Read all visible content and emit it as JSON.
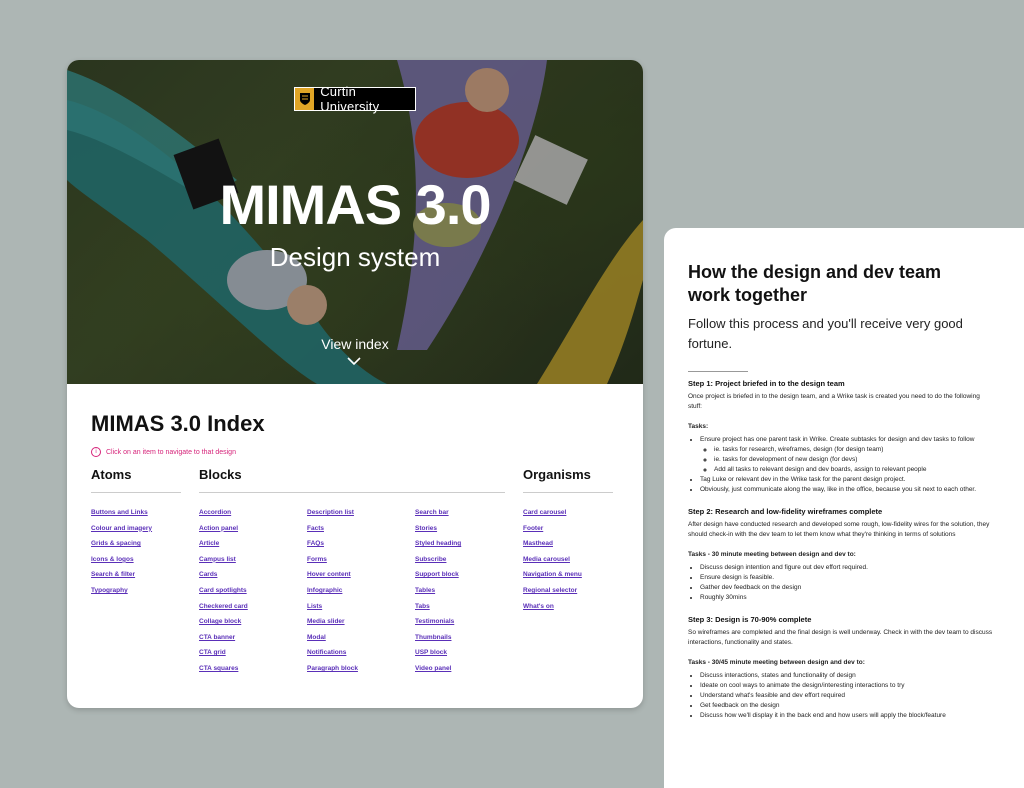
{
  "hero": {
    "brand": "Curtin University",
    "title": "MIMAS 3.0",
    "subtitle": "Design system",
    "view_index": "View index"
  },
  "index": {
    "title": "MIMAS 3.0 Index",
    "hint": "Click on an item to navigate to that design",
    "atoms": {
      "heading": "Atoms",
      "items": [
        "Buttons and Links",
        "Colour and imagery",
        "Grids & spacing",
        "Icons & logos",
        "Search & filter",
        "Typography"
      ]
    },
    "blocks": {
      "heading": "Blocks",
      "col1": [
        "Accordion",
        "Action panel",
        "Article",
        "Campus list",
        "Cards",
        "Card spotlights",
        "Checkered card",
        "Collage block",
        "CTA banner",
        "CTA grid",
        "CTA squares"
      ],
      "col2": [
        "Description list",
        "Facts",
        "FAQs",
        "Forms",
        "Hover content",
        "Infographic",
        "Lists",
        "Media slider",
        "Modal",
        "Notifications",
        "Paragraph block"
      ],
      "col3": [
        "Search bar",
        "Stories",
        "Styled heading",
        "Subscribe",
        "Support block",
        "Tables",
        "Tabs",
        "Testimonials",
        "Thumbnails",
        "USP block",
        "Video panel"
      ]
    },
    "organisms": {
      "heading": "Organisms",
      "items": [
        "Card carousel",
        "Footer",
        "Masthead",
        "Media carousel",
        "Navigation & menu",
        "Regional selector",
        "What's on"
      ]
    }
  },
  "process": {
    "title": "How the design and dev team work together",
    "intro": "Follow this process and you'll receive very good fortune.",
    "step1": {
      "heading": "Step 1: Project briefed in to the design team",
      "desc": "Once project is briefed in to the design team, and a Wrike task is created you need to do the following stuff:",
      "tasks_label": "Tasks:",
      "t1": "Ensure project has one parent task in Wrike. Create subtasks for design and dev tasks to follow",
      "t1a": "ie. tasks for research, wireframes, design (for design team)",
      "t1b": "ie. tasks for development of new design (for devs)",
      "t1c": "Add all tasks to relevant design and dev boards, assign to relevant people",
      "t2": "Tag Luke or relevant dev in the Wrike task for the parent design project.",
      "t3": "Obviously, just communicate along the way, like in the office, because you sit next to each other."
    },
    "step2": {
      "heading": "Step 2: Research and low-fidelity wireframes complete",
      "desc": "After design have conducted research and developed some rough, low-fidelity wires for the solution, they should check-in with the dev team to let them know what they're thinking in terms of solutions",
      "tasks_label": "Tasks - 30 minute meeting between design and dev to:",
      "t1": "Discuss design intention and figure out dev effort required.",
      "t2": "Ensure design is feasible.",
      "t3": "Gather dev feedback on the design",
      "t4": "Roughly 30mins"
    },
    "step3": {
      "heading": "Step 3: Design is 70-90% complete",
      "desc": "So wireframes are completed and the final design is well underway. Check in with the dev team to discuss interactions, functionality and states.",
      "tasks_label": "Tasks - 30/45 minute meeting between design and dev to:",
      "t1": "Discuss interactions, states and functionality of design",
      "t2": "Ideate on cool ways to animate the design/interesting interactions to try",
      "t3": "Understand what's feasible and dev effort required",
      "t4": "Get feedback on the design",
      "t5": "Discuss how we'll display it in the back end and how users will apply the block/feature"
    }
  },
  "colors": {
    "background": "#adb6b4",
    "link": "#5a2fb8",
    "hint": "#d6247a",
    "brand_gold": "#e0a526"
  }
}
